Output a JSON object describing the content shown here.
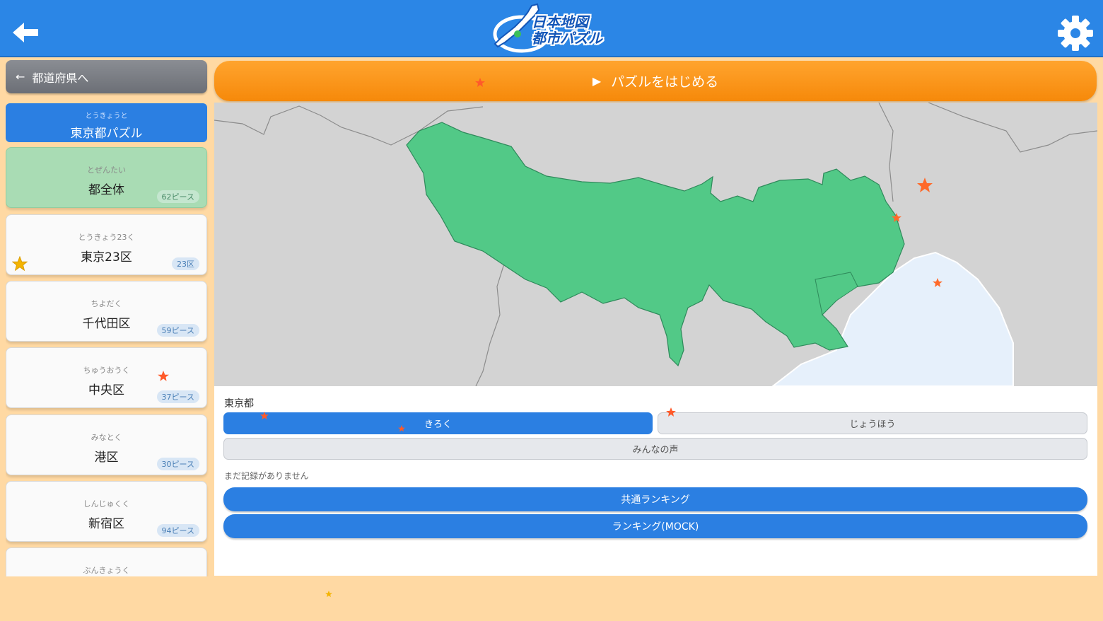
{
  "header": {
    "logo_line1": "日本地図",
    "logo_line2": "都市パズル",
    "back_icon": "arrow-left-icon",
    "settings_icon": "gear-icon"
  },
  "sidebar": {
    "back_label": "都道府県へ",
    "current": {
      "ruby": "とうきょうと",
      "name": "東京都パズル"
    },
    "items": [
      {
        "ruby": "とぜんたい",
        "name": "都全体",
        "count": "62ピース"
      },
      {
        "ruby": "とうきょう23く",
        "name": "東京23区",
        "count": "23区"
      },
      {
        "ruby": "ちよだく",
        "name": "千代田区",
        "count": "59ピース"
      },
      {
        "ruby": "ちゅうおうく",
        "name": "中央区",
        "count": "37ピース"
      },
      {
        "ruby": "みなとく",
        "name": "港区",
        "count": "30ピース"
      },
      {
        "ruby": "しんじゅくく",
        "name": "新宿区",
        "count": "94ピース"
      },
      {
        "ruby": "ぶんきょうく",
        "name": ""
      }
    ]
  },
  "main": {
    "start_label": "パズルをはじめる",
    "panel_title": "東京都",
    "tabs": {
      "record": "きろく",
      "info": "じょうほう",
      "voices": "みんなの声"
    },
    "no_record": "まだ記録がありません",
    "ranking_common": "共通ランキング",
    "ranking_mock": "ランキング(MOCK)"
  },
  "colors": {
    "header_blue": "#2b86e6",
    "accent_blue": "#2b7fe2",
    "orange": "#f6890a",
    "map_green": "#52c987",
    "background": "#ffd9a3"
  }
}
